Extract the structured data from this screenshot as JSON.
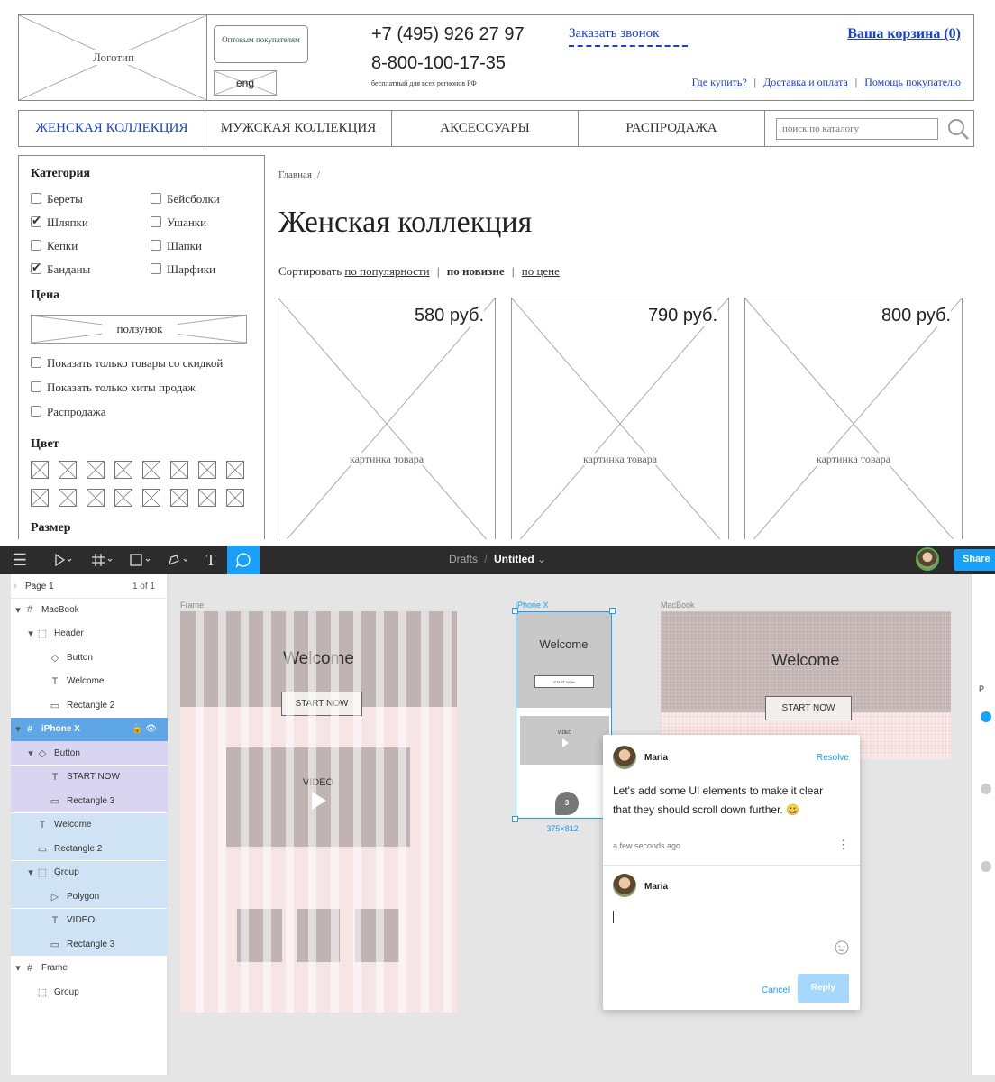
{
  "wireframe": {
    "header": {
      "logo": "Логотип",
      "wholesale_button": "Оптовым покупателям",
      "lang_button": "eng",
      "phone1": "+7 (495) 926 27 97",
      "phone2": "8-800-100-17-35",
      "phone_note": "бесплатный для всех регионов РФ",
      "callback_link": "Заказать звонок",
      "cart_link": "Ваша корзина (0)",
      "where_buy": "Где купить?",
      "delivery": "Доставка и оплата",
      "help": "Помощь покупателю",
      "separator": "|"
    },
    "nav": {
      "items": [
        "ЖЕНСКАЯ КОЛЛЕКЦИЯ",
        "МУЖСКАЯ КОЛЛЕКЦИЯ",
        "АКСЕССУАРЫ",
        "РАСПРОДАЖА"
      ],
      "search_placeholder": "поиск по каталогу"
    },
    "sidebar": {
      "category_title": "Категория",
      "categories": [
        {
          "label": "Береты",
          "checked": false
        },
        {
          "label": "Бейсболки",
          "checked": false
        },
        {
          "label": "Шляпки",
          "checked": true
        },
        {
          "label": "Ушанки",
          "checked": false
        },
        {
          "label": "Кепки",
          "checked": false
        },
        {
          "label": "Шапки",
          "checked": false
        },
        {
          "label": "Банданы",
          "checked": true
        },
        {
          "label": "Шарфики",
          "checked": false
        }
      ],
      "price_title": "Цена",
      "slider_label": "ползунок",
      "filters": [
        "Показать только товары со скидкой",
        "Показать только хиты продаж",
        "Распродажа"
      ],
      "color_title": "Цвет",
      "size_title": "Размер"
    },
    "content": {
      "breadcrumb": "Главная",
      "breadcrumb_sep": "/",
      "title": "Женская коллекция",
      "sort_label": "Сортировать",
      "sort_popular": "по популярности",
      "sort_new": "по новизне",
      "sort_price": "по цене",
      "sep": "|",
      "products": [
        {
          "price": "580 руб.",
          "image_label": "картинка товара"
        },
        {
          "price": "790 руб.",
          "image_label": "картинка товара"
        },
        {
          "price": "800 руб.",
          "image_label": "картинка товара"
        }
      ]
    }
  },
  "figma": {
    "toolbar": {
      "breadcrumb_root": "Drafts",
      "breadcrumb_sep": "/",
      "file_name": "Untitled",
      "share": "Share",
      "accent": "#18a0fb"
    },
    "layers": {
      "page_label": "Page 1",
      "page_count": "1 of 1",
      "items": [
        {
          "label": "MacBook",
          "icon": "frame-icon"
        },
        {
          "label": "Header",
          "icon": "group-icon"
        },
        {
          "label": "Button",
          "icon": "component-icon"
        },
        {
          "label": "Welcome",
          "icon": "text-icon"
        },
        {
          "label": "Rectangle 2",
          "icon": "rectangle-icon"
        },
        {
          "label": "iPhone X",
          "icon": "frame-icon"
        },
        {
          "label": "Button",
          "icon": "component-icon"
        },
        {
          "label": "START NOW",
          "icon": "text-icon"
        },
        {
          "label": "Rectangle 3",
          "icon": "rectangle-icon"
        },
        {
          "label": "Welcome",
          "icon": "text-icon"
        },
        {
          "label": "Rectangle 2",
          "icon": "rectangle-icon"
        },
        {
          "label": "Group",
          "icon": "group-icon"
        },
        {
          "label": "Polygon",
          "icon": "polygon-icon"
        },
        {
          "label": "VIDEO",
          "icon": "text-icon"
        },
        {
          "label": "Rectangle 3",
          "icon": "rectangle-icon"
        },
        {
          "label": "Frame",
          "icon": "frame-icon"
        },
        {
          "label": "Group",
          "icon": "group-icon"
        }
      ]
    },
    "canvas": {
      "frame_label": "Frame",
      "frame_welcome": "Welcome",
      "frame_button": "START NOW",
      "frame_video": "VIDEO",
      "iphone_label": "iPhone X",
      "iphone_welcome": "Welcome",
      "iphone_button": "START NOW",
      "iphone_video": "VIDEO",
      "iphone_size": "375×812",
      "comment_pin": "3",
      "macbook_label": "MacBook",
      "macbook_welcome": "Welcome",
      "macbook_button": "START NOW"
    },
    "comment": {
      "author": "Maria",
      "resolve": "Resolve",
      "text": "Let's add some UI elements to make it clear that they should scroll down further. 😀",
      "time": "a few seconds ago",
      "reply_author": "Maria",
      "cancel": "Cancel",
      "reply": "Reply"
    },
    "right_panel_letter": "P"
  }
}
